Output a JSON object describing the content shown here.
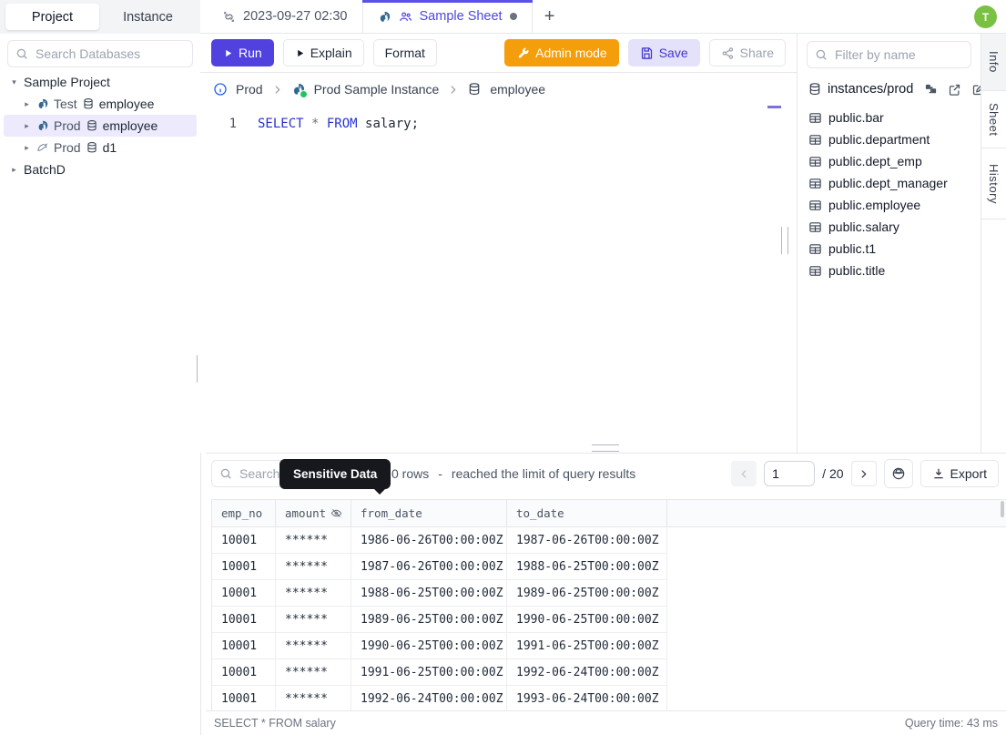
{
  "colors": {
    "accent": "#4f46e5",
    "admin_orange": "#f59e0b",
    "avatar_green": "#7ac143",
    "selection_bg": "#eceafc"
  },
  "icons": {
    "search": "magnifier",
    "unlink": "broken-chain",
    "postgres": "elephant",
    "mysql": "dolphin",
    "database": "cylinder",
    "table": "grid",
    "people": "two-persons",
    "run": "play-triangle",
    "wrench": "wrench",
    "save": "floppy-disk",
    "share": "share-nodes",
    "info": "info-circle",
    "chevron": "angle-right",
    "sensitive": "eye-off",
    "schema": "diagram-squares",
    "external": "external-link",
    "edit": "pencil-square",
    "download": "download-tray",
    "masking": "hat-circle"
  },
  "left_sidebar": {
    "tabs": {
      "project": "Project",
      "instance": "Instance"
    },
    "search_placeholder": "Search Databases",
    "tree": {
      "project_label": "Sample Project",
      "items": [
        {
          "env": "Test",
          "db": "employee",
          "engine": "postgres"
        },
        {
          "env": "Prod",
          "db": "employee",
          "engine": "postgres",
          "selected": true
        },
        {
          "env": "Prod",
          "db": "d1",
          "engine": "mysql"
        }
      ],
      "batch_label": "BatchD"
    }
  },
  "tab_bar": {
    "history_tab": "2023-09-27 02:30",
    "sheet_tab": "Sample Sheet",
    "add_label": "+"
  },
  "toolbar": {
    "run": "Run",
    "explain": "Explain",
    "format": "Format",
    "admin": "Admin mode",
    "save": "Save",
    "share": "Share"
  },
  "breadcrumb": {
    "env": "Prod",
    "instance": "Prod Sample Instance",
    "database": "employee"
  },
  "editor": {
    "line_number": "1",
    "kw1": "SELECT",
    "star": " * ",
    "kw2": "FROM",
    "rest": " salary;"
  },
  "right_panel": {
    "filter_placeholder": "Filter by name",
    "path": "instances/prod",
    "tables": [
      "public.bar",
      "public.department",
      "public.dept_emp",
      "public.dept_manager",
      "public.employee",
      "public.salary",
      "public.t1",
      "public.title"
    ]
  },
  "side_tabs": {
    "info": "Info",
    "sheet": "Sheet",
    "history": "History"
  },
  "avatar": "T",
  "results": {
    "search_placeholder": "Search",
    "tooltip": "Sensitive Data",
    "rows_text": "0 rows",
    "dash": "-",
    "limit_text": "reached the limit of query results",
    "page": "1",
    "page_total": "/ 20",
    "export": "Export",
    "columns": [
      "emp_no",
      "amount",
      "from_date",
      "to_date"
    ],
    "rows": [
      [
        "10001",
        "******",
        "1986-06-26T00:00:00Z",
        "1987-06-26T00:00:00Z"
      ],
      [
        "10001",
        "******",
        "1987-06-26T00:00:00Z",
        "1988-06-25T00:00:00Z"
      ],
      [
        "10001",
        "******",
        "1988-06-25T00:00:00Z",
        "1989-06-25T00:00:00Z"
      ],
      [
        "10001",
        "******",
        "1989-06-25T00:00:00Z",
        "1990-06-25T00:00:00Z"
      ],
      [
        "10001",
        "******",
        "1990-06-25T00:00:00Z",
        "1991-06-25T00:00:00Z"
      ],
      [
        "10001",
        "******",
        "1991-06-25T00:00:00Z",
        "1992-06-24T00:00:00Z"
      ],
      [
        "10001",
        "******",
        "1992-06-24T00:00:00Z",
        "1993-06-24T00:00:00Z"
      ]
    ],
    "status_sql": "SELECT * FROM salary",
    "query_time": "Query time: 43 ms"
  }
}
